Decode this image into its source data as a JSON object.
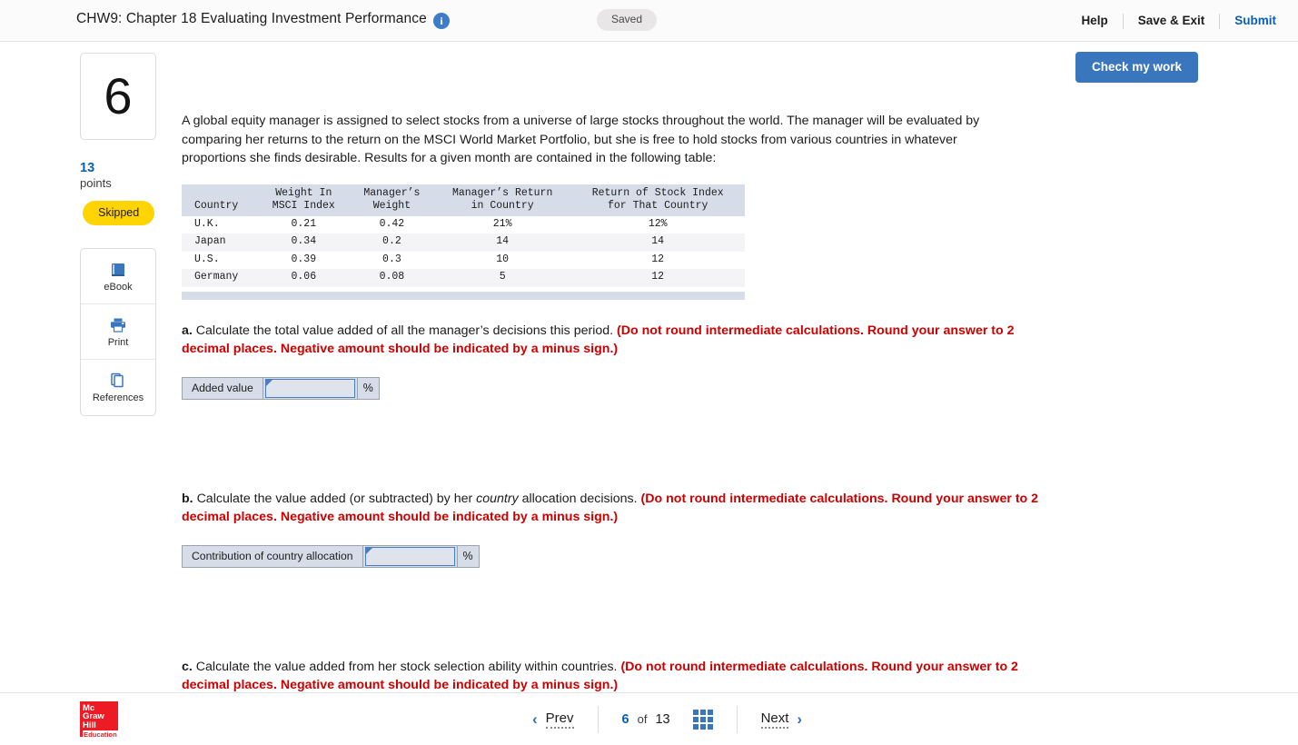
{
  "topbar": {
    "title": "CHW9: Chapter 18 Evaluating Investment Performance",
    "info_icon": "info-icon",
    "status": "Saved",
    "help_label": "Help",
    "save_exit_label": "Save & Exit",
    "submit_label": "Submit"
  },
  "rail": {
    "question_number": "6",
    "points_value": "13",
    "points_label": "points",
    "status_badge": "Skipped",
    "tools": [
      {
        "label": "eBook",
        "icon": "book-icon"
      },
      {
        "label": "Print",
        "icon": "printer-icon"
      },
      {
        "label": "References",
        "icon": "copy-pages-icon"
      }
    ]
  },
  "actions": {
    "check_my_work": "Check my work"
  },
  "question": {
    "body": "A global equity manager is assigned to select stocks from a universe of large stocks throughout the world. The manager will be evaluated by comparing her returns to the return on the MSCI World Market Portfolio, but she is free to hold stocks from various countries in whatever proportions she finds desirable. Results for a given month are contained in the following table:"
  },
  "table": {
    "headers": [
      "Country",
      "Weight In\nMSCI Index",
      "Manager’s\nWeight",
      "Manager’s Return\nin Country",
      "Return of Stock Index\nfor That Country"
    ],
    "rows": [
      {
        "country": "U.K.",
        "msci_weight": "0.21",
        "mgr_weight": "0.42",
        "mgr_return": "21%",
        "index_return": "12%"
      },
      {
        "country": "Japan",
        "msci_weight": "0.34",
        "mgr_weight": "0.2",
        "mgr_return": "14",
        "index_return": "14"
      },
      {
        "country": "U.S.",
        "msci_weight": "0.39",
        "mgr_weight": "0.3",
        "mgr_return": "10",
        "index_return": "12"
      },
      {
        "country": "Germany",
        "msci_weight": "0.06",
        "mgr_weight": "0.08",
        "mgr_return": "5",
        "index_return": "12"
      }
    ]
  },
  "parts": {
    "a": {
      "letter": "a.",
      "prompt": "Calculate the total value added of all the manager’s decisions this period.",
      "instruction": "(Do not round intermediate calculations. Round your answer to 2 decimal places. Negative amount should be indicated by a minus sign.)",
      "field_label": "Added value",
      "field_value": "",
      "field_suffix": "%"
    },
    "b": {
      "letter": "b.",
      "prompt_pre": "Calculate the value added (or subtracted) by her ",
      "prompt_italic": "country",
      "prompt_post": " allocation decisions.",
      "instruction": "(Do not round intermediate calculations. Round your answer to 2 decimal places. Negative amount should be indicated by a minus sign.)",
      "field_label": "Contribution of country allocation",
      "field_value": "",
      "field_suffix": "%"
    },
    "c": {
      "letter": "c.",
      "prompt": "Calculate the value added from her stock selection ability within countries.",
      "instruction": "(Do not round intermediate calculations. Round your answer to 2 decimal places. Negative amount should be indicated by a minus sign.)"
    }
  },
  "footer": {
    "logo_line1": "Mc",
    "logo_line2": "Graw",
    "logo_line3": "Hill",
    "logo_line4": "Education",
    "prev_label": "Prev",
    "next_label": "Next",
    "page_current": "6",
    "page_of": "of",
    "page_total": "13",
    "grid_icon": "grid-icon"
  },
  "colors": {
    "accent_blue": "#0b5fb0",
    "button_blue": "#3a76bd",
    "table_header": "#d6dce8",
    "warning_red": "#cc0000",
    "skipped_yellow": "#ffd400",
    "logo_red": "#ed1c24"
  }
}
